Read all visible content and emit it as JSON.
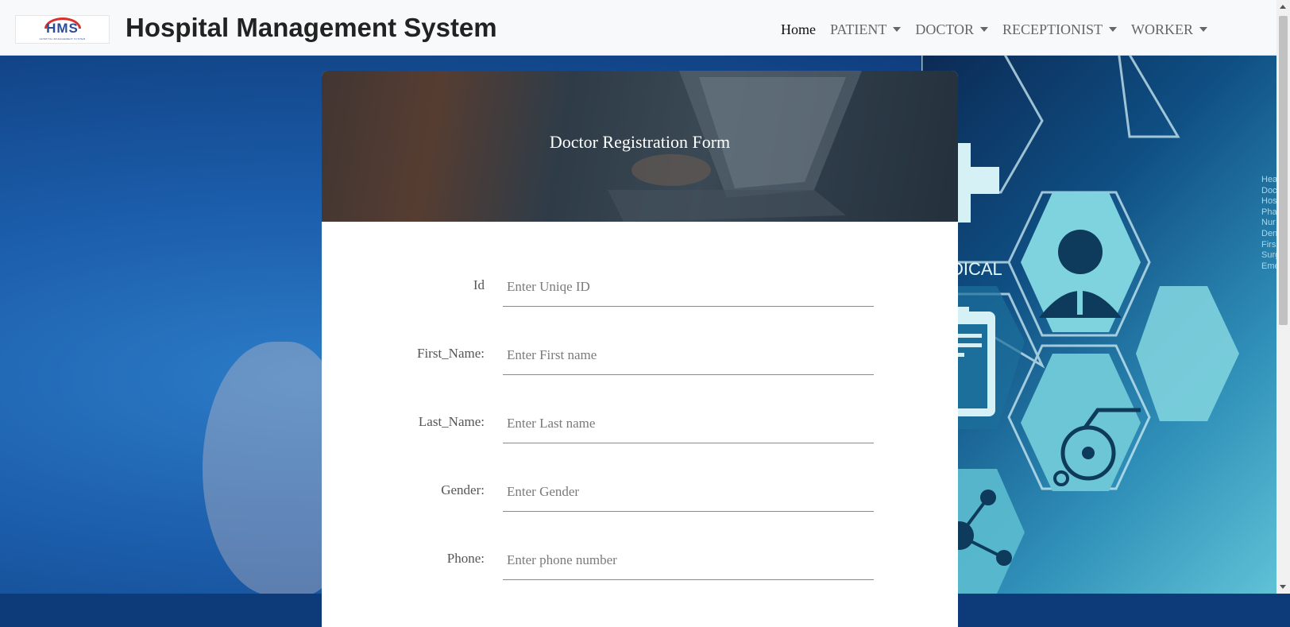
{
  "app": {
    "brand_title": "Hospital Management System",
    "logo_text": "HMS",
    "logo_subtitle": "HOSPITAL MANAGEMENT SYSTEM"
  },
  "nav": {
    "items": [
      {
        "label": "Home",
        "dropdown": false
      },
      {
        "label": "PATIENT",
        "dropdown": true
      },
      {
        "label": "DOCTOR",
        "dropdown": true
      },
      {
        "label": "RECEPTIONIST",
        "dropdown": true
      },
      {
        "label": "WORKER",
        "dropdown": true
      }
    ]
  },
  "background": {
    "medical_label": "MEDICAL",
    "side_list": [
      "Hea",
      "Doc",
      "Hos",
      "Pha",
      "Nur",
      "Den",
      "Firs",
      "Surg",
      "Eme"
    ]
  },
  "form": {
    "title": "Doctor Registration Form",
    "fields": [
      {
        "label": "Id",
        "placeholder": "Enter Uniqe ID",
        "value": ""
      },
      {
        "label": "First_Name:",
        "placeholder": "Enter First name",
        "value": ""
      },
      {
        "label": "Last_Name:",
        "placeholder": "Enter Last name",
        "value": ""
      },
      {
        "label": "Gender:",
        "placeholder": "Enter Gender",
        "value": ""
      },
      {
        "label": "Phone:",
        "placeholder": "Enter phone number",
        "value": ""
      }
    ]
  },
  "colors": {
    "navbar_bg": "#f8f9fa",
    "header_overlay": "#3d4a55",
    "background_blue": "#1b5ca9",
    "hex_teal": "#7fd3de"
  }
}
